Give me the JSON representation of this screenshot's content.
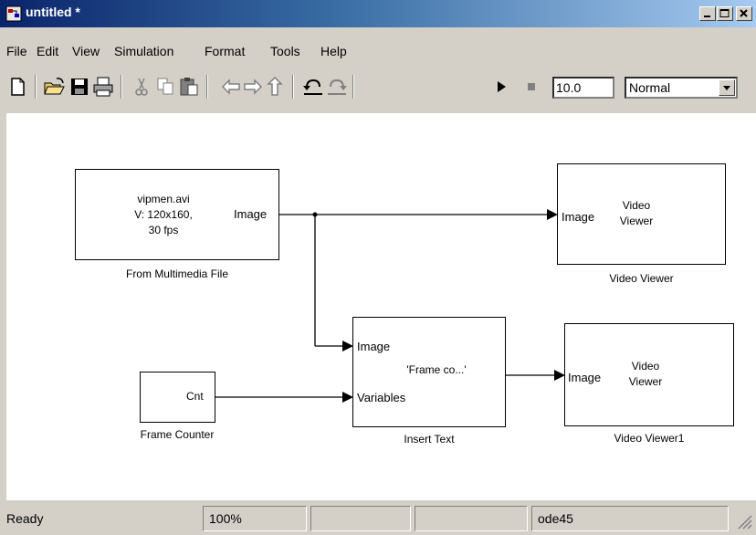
{
  "window": {
    "title": "untitled *"
  },
  "menu": [
    "File",
    "Edit",
    "View",
    "Simulation",
    "Format",
    "Tools",
    "Help"
  ],
  "toolbar": {
    "stop_time": "10.0",
    "sim_mode": "Normal"
  },
  "blocks": {
    "from_multimedia": {
      "line1": "vipmen.avi",
      "line2": "V: 120x160,",
      "line3": "30 fps",
      "out_port": "Image",
      "label": "From Multimedia File"
    },
    "video_viewer": {
      "in_port": "Image",
      "text1": "Video",
      "text2": "Viewer",
      "label": "Video Viewer"
    },
    "insert_text": {
      "in_port1": "Image",
      "in_port2": "Variables",
      "text": "'Frame co...'",
      "label": "Insert Text"
    },
    "frame_counter": {
      "out_port": "Cnt",
      "label": "Frame Counter"
    },
    "video_viewer1": {
      "in_port": "Image",
      "text1": "Video",
      "text2": "Viewer",
      "label": "Video Viewer1"
    }
  },
  "status": {
    "state": "Ready",
    "zoom": "100%",
    "solver": "ode45"
  }
}
